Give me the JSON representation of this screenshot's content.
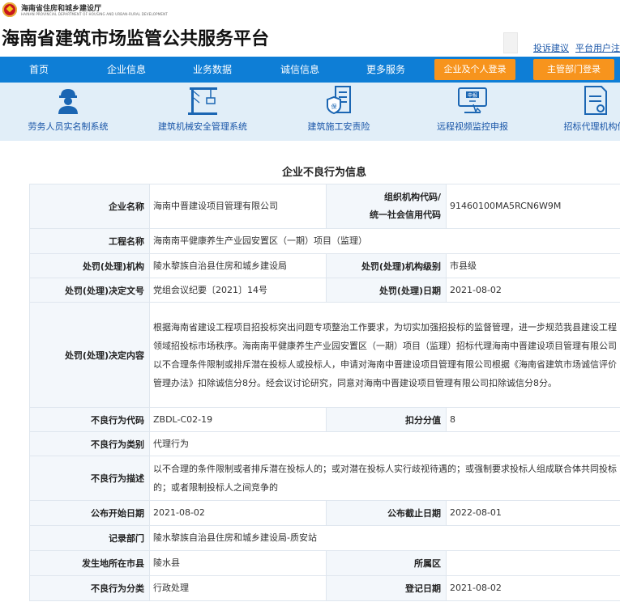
{
  "header": {
    "org_name_cn": "海南省住房和城乡建设厅",
    "org_name_en": "HAINAN PROVINCIAL DEPARTMENT OF HOUSING AND URBAN-RURAL DEVELOPMENT",
    "site_title": "海南省建筑市场监管公共服务平台",
    "links": [
      "投诉建议",
      "平台用户注"
    ]
  },
  "nav": {
    "items": [
      "首页",
      "企业信息",
      "业务数据",
      "诚信信息",
      "更多服务"
    ],
    "buttons": [
      "企业及个人登录",
      "主管部门登录"
    ]
  },
  "systems": [
    {
      "label": "劳务人员实名制系统",
      "icon": "worker-icon"
    },
    {
      "label": "建筑机械安全管理系统",
      "icon": "crane-icon"
    },
    {
      "label": "建筑施工安责险",
      "icon": "insurance-doc-icon"
    },
    {
      "label": "远程视频监控申报",
      "icon": "monitor-report-icon"
    },
    {
      "label": "招标代理机构信",
      "icon": "document-icon"
    }
  ],
  "section_title": "企业不良行为信息",
  "record": {
    "enterprise_name_label": "企业名称",
    "enterprise_name": "海南中晋建设项目管理有限公司",
    "org_code_label_1": "组织机构代码/",
    "org_code_label_2": "统一社会信用代码",
    "org_code": "91460100MA5RCN6W9M",
    "project_name_label": "工程名称",
    "project_name": "海南南平健康养生产业园安置区（一期）项目（监理）",
    "authority_label": "处罚(处理)机构",
    "authority": "陵水黎族自治县住房和城乡建设局",
    "authority_level_label": "处罚(处理)机构级别",
    "authority_level": "市县级",
    "decision_no_label": "处罚(处理)决定文号",
    "decision_no": "党组会议纪要〔2021〕14号",
    "decision_date_label": "处罚(处理)日期",
    "decision_date": "2021-08-02",
    "decision_content_label": "处罚(处理)决定内容",
    "decision_content": "根据海南省建设工程项目招投标突出问题专项整治工作要求，为切实加强招投标的监督管理，进一步规范我县建设工程领域招投标市场秩序。海南南平健康养生产业园安置区（一期）项目（监理）招标代理海南中晋建设项目管理有限公司以不合理条件限制或排斥潜在投标人或投标人，申请对海南中晋建设项目管理有限公司根据《海南省建筑市场诚信评价管理办法》扣除诚信分8分。经会议讨论研究，同意对海南中晋建设项目管理有限公司扣除诚信分8分。",
    "behavior_code_label": "不良行为代码",
    "behavior_code": "ZBDL-C02-19",
    "deduction_label": "扣分分值",
    "deduction": "8",
    "behavior_type_label": "不良行为类别",
    "behavior_type": "代理行为",
    "behavior_desc_label": "不良行为描述",
    "behavior_desc": "以不合理的条件限制或者排斥潜在投标人的；或对潜在投标人实行歧视待遇的；或强制要求投标人组成联合体共同投标的；或者限制投标人之间竞争的",
    "publish_start_label": "公布开始日期",
    "publish_start": "2021-08-02",
    "publish_end_label": "公布截止日期",
    "publish_end": "2022-08-01",
    "record_dept_label": "记录部门",
    "record_dept": "陵水黎族自治县住房和城乡建设局-质安站",
    "location_label": "发生地所在市县",
    "location": "陵水县",
    "district_label": "所属区",
    "district": "",
    "category_label": "不良行为分类",
    "category": "行政处理",
    "register_date_label": "登记日期",
    "register_date": "2021-08-02"
  },
  "colors": {
    "nav_bg": "#0e7ed6",
    "login_button": "#f7941d",
    "icon_strip_bg": "#e1eef8",
    "link": "#1a56a8"
  }
}
